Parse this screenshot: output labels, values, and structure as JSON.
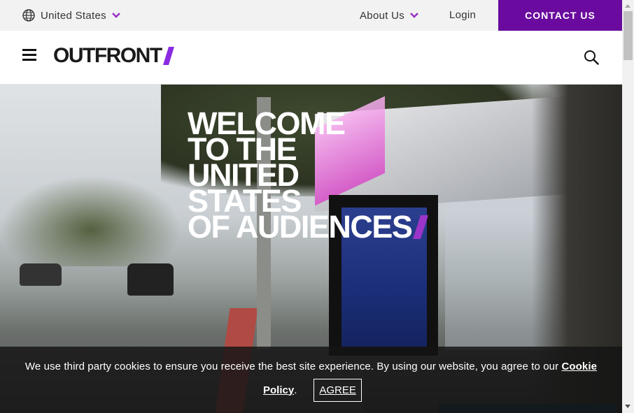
{
  "topbar": {
    "region_label": "United States",
    "about_label": "About Us",
    "login_label": "Login",
    "contact_label": "CONTACT US"
  },
  "header": {
    "logo_text": "OUTFRONT"
  },
  "hero": {
    "headline_lines": [
      "WELCOME",
      "TO THE",
      "UNITED",
      "STATES",
      "OF AUDIENCES"
    ]
  },
  "cookie": {
    "message": "We use third party cookies to ensure you receive the best site experience. By using our website, you agree to our ",
    "policy_bold": "Cookie",
    "policy_line2": "Policy",
    "period": ".",
    "agree_label": "AGREE"
  },
  "colors": {
    "brand_purple": "#6a0a9e",
    "accent_purple": "#9b34c8"
  },
  "icons": {
    "globe": "globe-icon",
    "chevron": "chevron-down-icon",
    "menu": "hamburger-menu-icon",
    "search": "search-icon"
  }
}
